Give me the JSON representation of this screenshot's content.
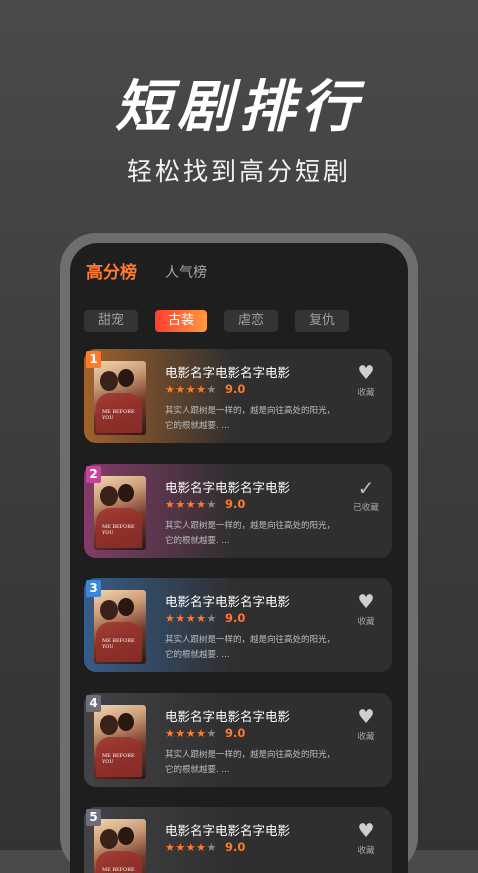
{
  "hero": {
    "title": "短剧排行",
    "subtitle": "轻松找到高分短剧"
  },
  "tabs": {
    "active": "高分榜",
    "other": "人气榜"
  },
  "chips": [
    "甜宠",
    "古装",
    "虐恋",
    "复仇"
  ],
  "active_chip": "古装",
  "cards": [
    {
      "rank": "1",
      "title": "电影名字电影名字电影",
      "rating_stars": 4,
      "score": "9.0",
      "desc": "其实人跟树是一样的，越是向往高处的阳光，它的根就越要. ...",
      "fav_label": "收藏",
      "fav_icon": "heart-icon",
      "rank_color": "#ff7a2e"
    },
    {
      "rank": "2",
      "title": "电影名字电影名字电影",
      "rating_stars": 4,
      "score": "9.0",
      "desc": "其实人跟树是一样的，越是向往高处的阳光，它的根就越要. ...",
      "fav_label": "已收藏",
      "fav_icon": "check-icon",
      "rank_color": "#c2479a"
    },
    {
      "rank": "3",
      "title": "电影名字电影名字电影",
      "rating_stars": 4,
      "score": "9.0",
      "desc": "其实人跟树是一样的，越是向往高处的阳光，它的根就越要. ...",
      "fav_label": "收藏",
      "fav_icon": "heart-icon",
      "rank_color": "#3d86d8"
    },
    {
      "rank": "4",
      "title": "电影名字电影名字电影",
      "rating_stars": 4,
      "score": "9.0",
      "desc": "其实人跟树是一样的，越是向往高处的阳光，它的根就越要. ...",
      "fav_label": "收藏",
      "fav_icon": "heart-icon",
      "rank_color": "#6e6e7a"
    },
    {
      "rank": "5",
      "title": "电影名字电影名字电影",
      "rating_stars": 4,
      "score": "9.0",
      "desc": "",
      "fav_label": "收藏",
      "fav_icon": "heart-icon",
      "rank_color": "#6e6e7a"
    }
  ],
  "poster_text": "ME BEFORE YOU",
  "colors": {
    "accent": "#ff7a2e",
    "background": "#1e1e1e",
    "card": "#2f2f2f"
  }
}
